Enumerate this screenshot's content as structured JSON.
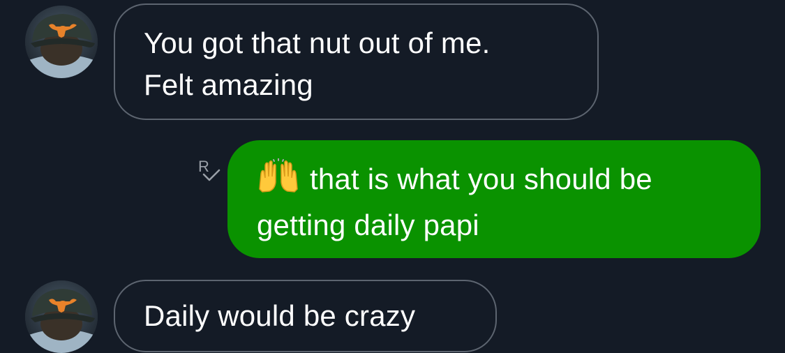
{
  "conversation": {
    "messages": [
      {
        "direction": "incoming",
        "lines": [
          "You got that nut out of me.",
          "Felt amazing"
        ]
      },
      {
        "direction": "outgoing",
        "emoji": "raising-hands",
        "lines": [
          "that is what you should be",
          "getting daily papi"
        ],
        "read_receipt": "R"
      },
      {
        "direction": "incoming",
        "lines": [
          "Daily would be crazy"
        ]
      }
    ]
  },
  "colors": {
    "background": "#141b26",
    "incoming_border": "#5d6570",
    "outgoing_bubble": "#0a9200",
    "text": "#ffffff",
    "receipt": "#9aa0a8",
    "avatar_logo": "#e8822a"
  },
  "icons": {
    "avatar": "contact-avatar",
    "emoji": "raising-hands-emoji",
    "receipt": "read-receipt-icon"
  }
}
